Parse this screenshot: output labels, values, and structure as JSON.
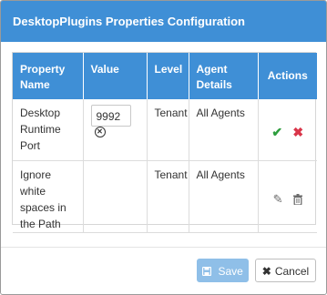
{
  "dialog": {
    "title": "DesktopPlugins Properties Configuration"
  },
  "table": {
    "headers": {
      "property_name": "Property Name",
      "value": "Value",
      "level": "Level",
      "agent_details": "Agent Details",
      "actions": "Actions"
    },
    "rows": [
      {
        "property_name": "Desktop Runtime Port",
        "value": "9992",
        "level": "Tenant",
        "agent_details": "All Agents",
        "actions": [
          "check-icon",
          "cross-icon"
        ]
      },
      {
        "property_name": "Ignore white spaces in the Path",
        "value": "",
        "level": "Tenant",
        "agent_details": "All Agents",
        "actions": [
          "edit-icon",
          "trash-icon"
        ]
      }
    ]
  },
  "footer": {
    "save_label": "Save",
    "cancel_label": "Cancel"
  },
  "colors": {
    "header_blue": "#3f8fd6",
    "save_disabled": "#8fbfe8",
    "check_green": "#2e9e3e",
    "cross_red": "#d9364a"
  }
}
